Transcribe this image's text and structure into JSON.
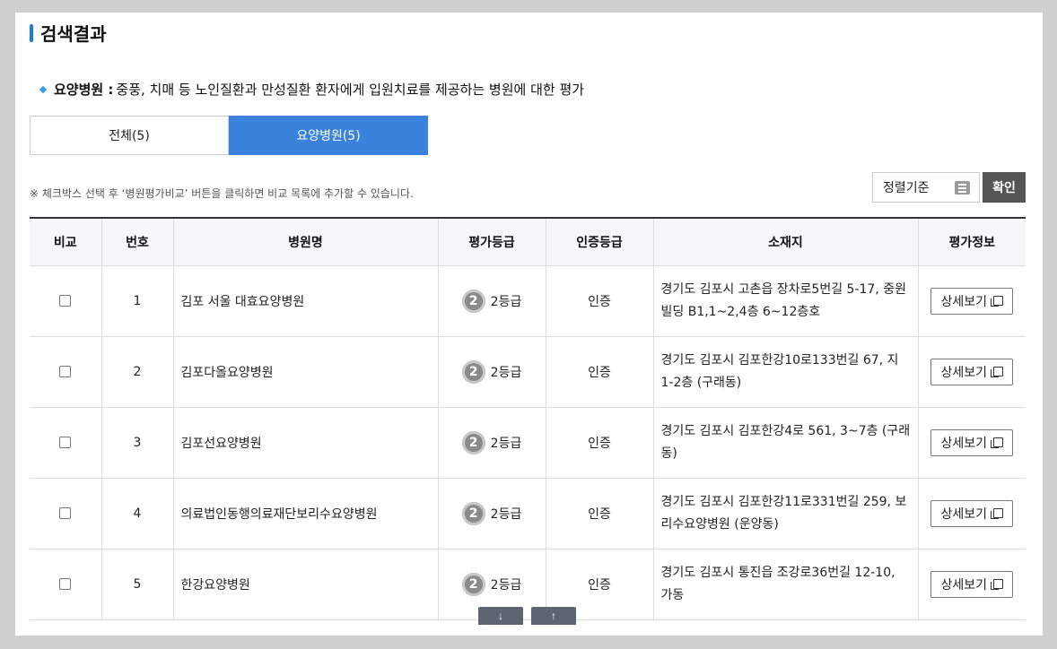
{
  "header": {
    "title": "검색결과"
  },
  "description": {
    "label": "요양병원 :",
    "text": "중풍, 치매 등 노인질환과 만성질환 환자에게 입원치료를 제공하는 병원에 대한 평가"
  },
  "tabs": [
    {
      "label": "전체(5)",
      "active": false
    },
    {
      "label": "요양병원(5)",
      "active": true
    }
  ],
  "note": "※ 체크박스 선택 후 ‘병원평가비교’ 버튼을 클릭하면 비교 목록에 추가할 수 있습니다.",
  "sort": {
    "label": "정렬기준",
    "icon": "list-icon"
  },
  "confirm_label": "확인",
  "table": {
    "headers": [
      "비교",
      "번호",
      "병원명",
      "평가등급",
      "인증등급",
      "소재지",
      "평가정보"
    ],
    "rows": [
      {
        "no": "1",
        "name": "김포 서울 대효요양병원",
        "grade_num": "2",
        "grade": "2등급",
        "cert": "인증",
        "addr": "경기도 김포시 고촌읍 장차로5번길 5-17, 중원빌딩 B1,1~2,4층 6~12층호",
        "detail": "상세보기"
      },
      {
        "no": "2",
        "name": "김포다올요양병원",
        "grade_num": "2",
        "grade": "2등급",
        "cert": "인증",
        "addr": "경기도 김포시 김포한강10로133번길 67, 지1-2층 (구래동)",
        "detail": "상세보기"
      },
      {
        "no": "3",
        "name": "김포선요양병원",
        "grade_num": "2",
        "grade": "2등급",
        "cert": "인증",
        "addr": "경기도 김포시 김포한강4로 561, 3~7층 (구래동)",
        "detail": "상세보기"
      },
      {
        "no": "4",
        "name": "의료법인동행의료재단보리수요양병원",
        "grade_num": "2",
        "grade": "2등급",
        "cert": "인증",
        "addr": "경기도 김포시 김포한강11로331번길 259, 보리수요양병원 (운양동)",
        "detail": "상세보기"
      },
      {
        "no": "5",
        "name": "한강요양병원",
        "grade_num": "2",
        "grade": "2등급",
        "cert": "인증",
        "addr": "경기도 김포시 통진읍 조강로36번길 12-10, 가동",
        "detail": "상세보기"
      }
    ]
  },
  "scroll": {
    "down": "↓",
    "up": "↑"
  }
}
